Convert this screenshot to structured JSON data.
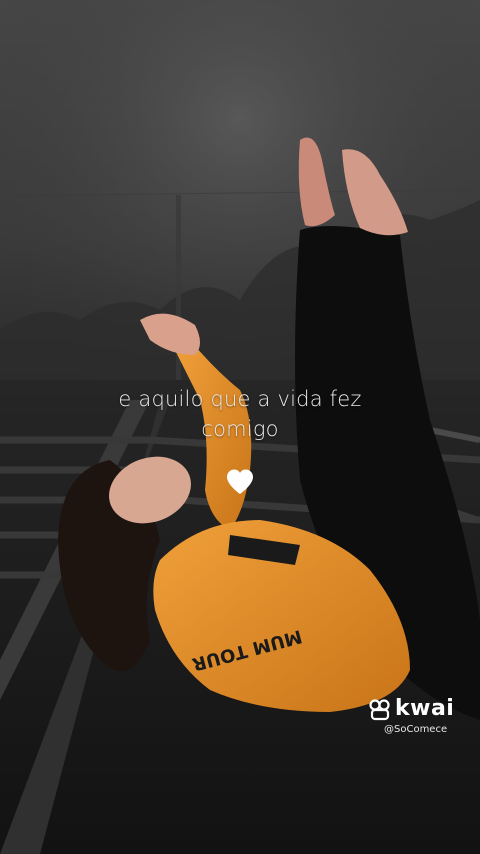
{
  "caption": {
    "line1": "e aquilo que a vida fez",
    "line2": "comigo"
  },
  "heart_icon": "white-heart",
  "watermark": {
    "brand": "kwai",
    "handle": "@SoComece"
  },
  "colors": {
    "sweater": "#e8902a",
    "caption_text": "#e9e9e9",
    "background": "#2a2a2a"
  }
}
